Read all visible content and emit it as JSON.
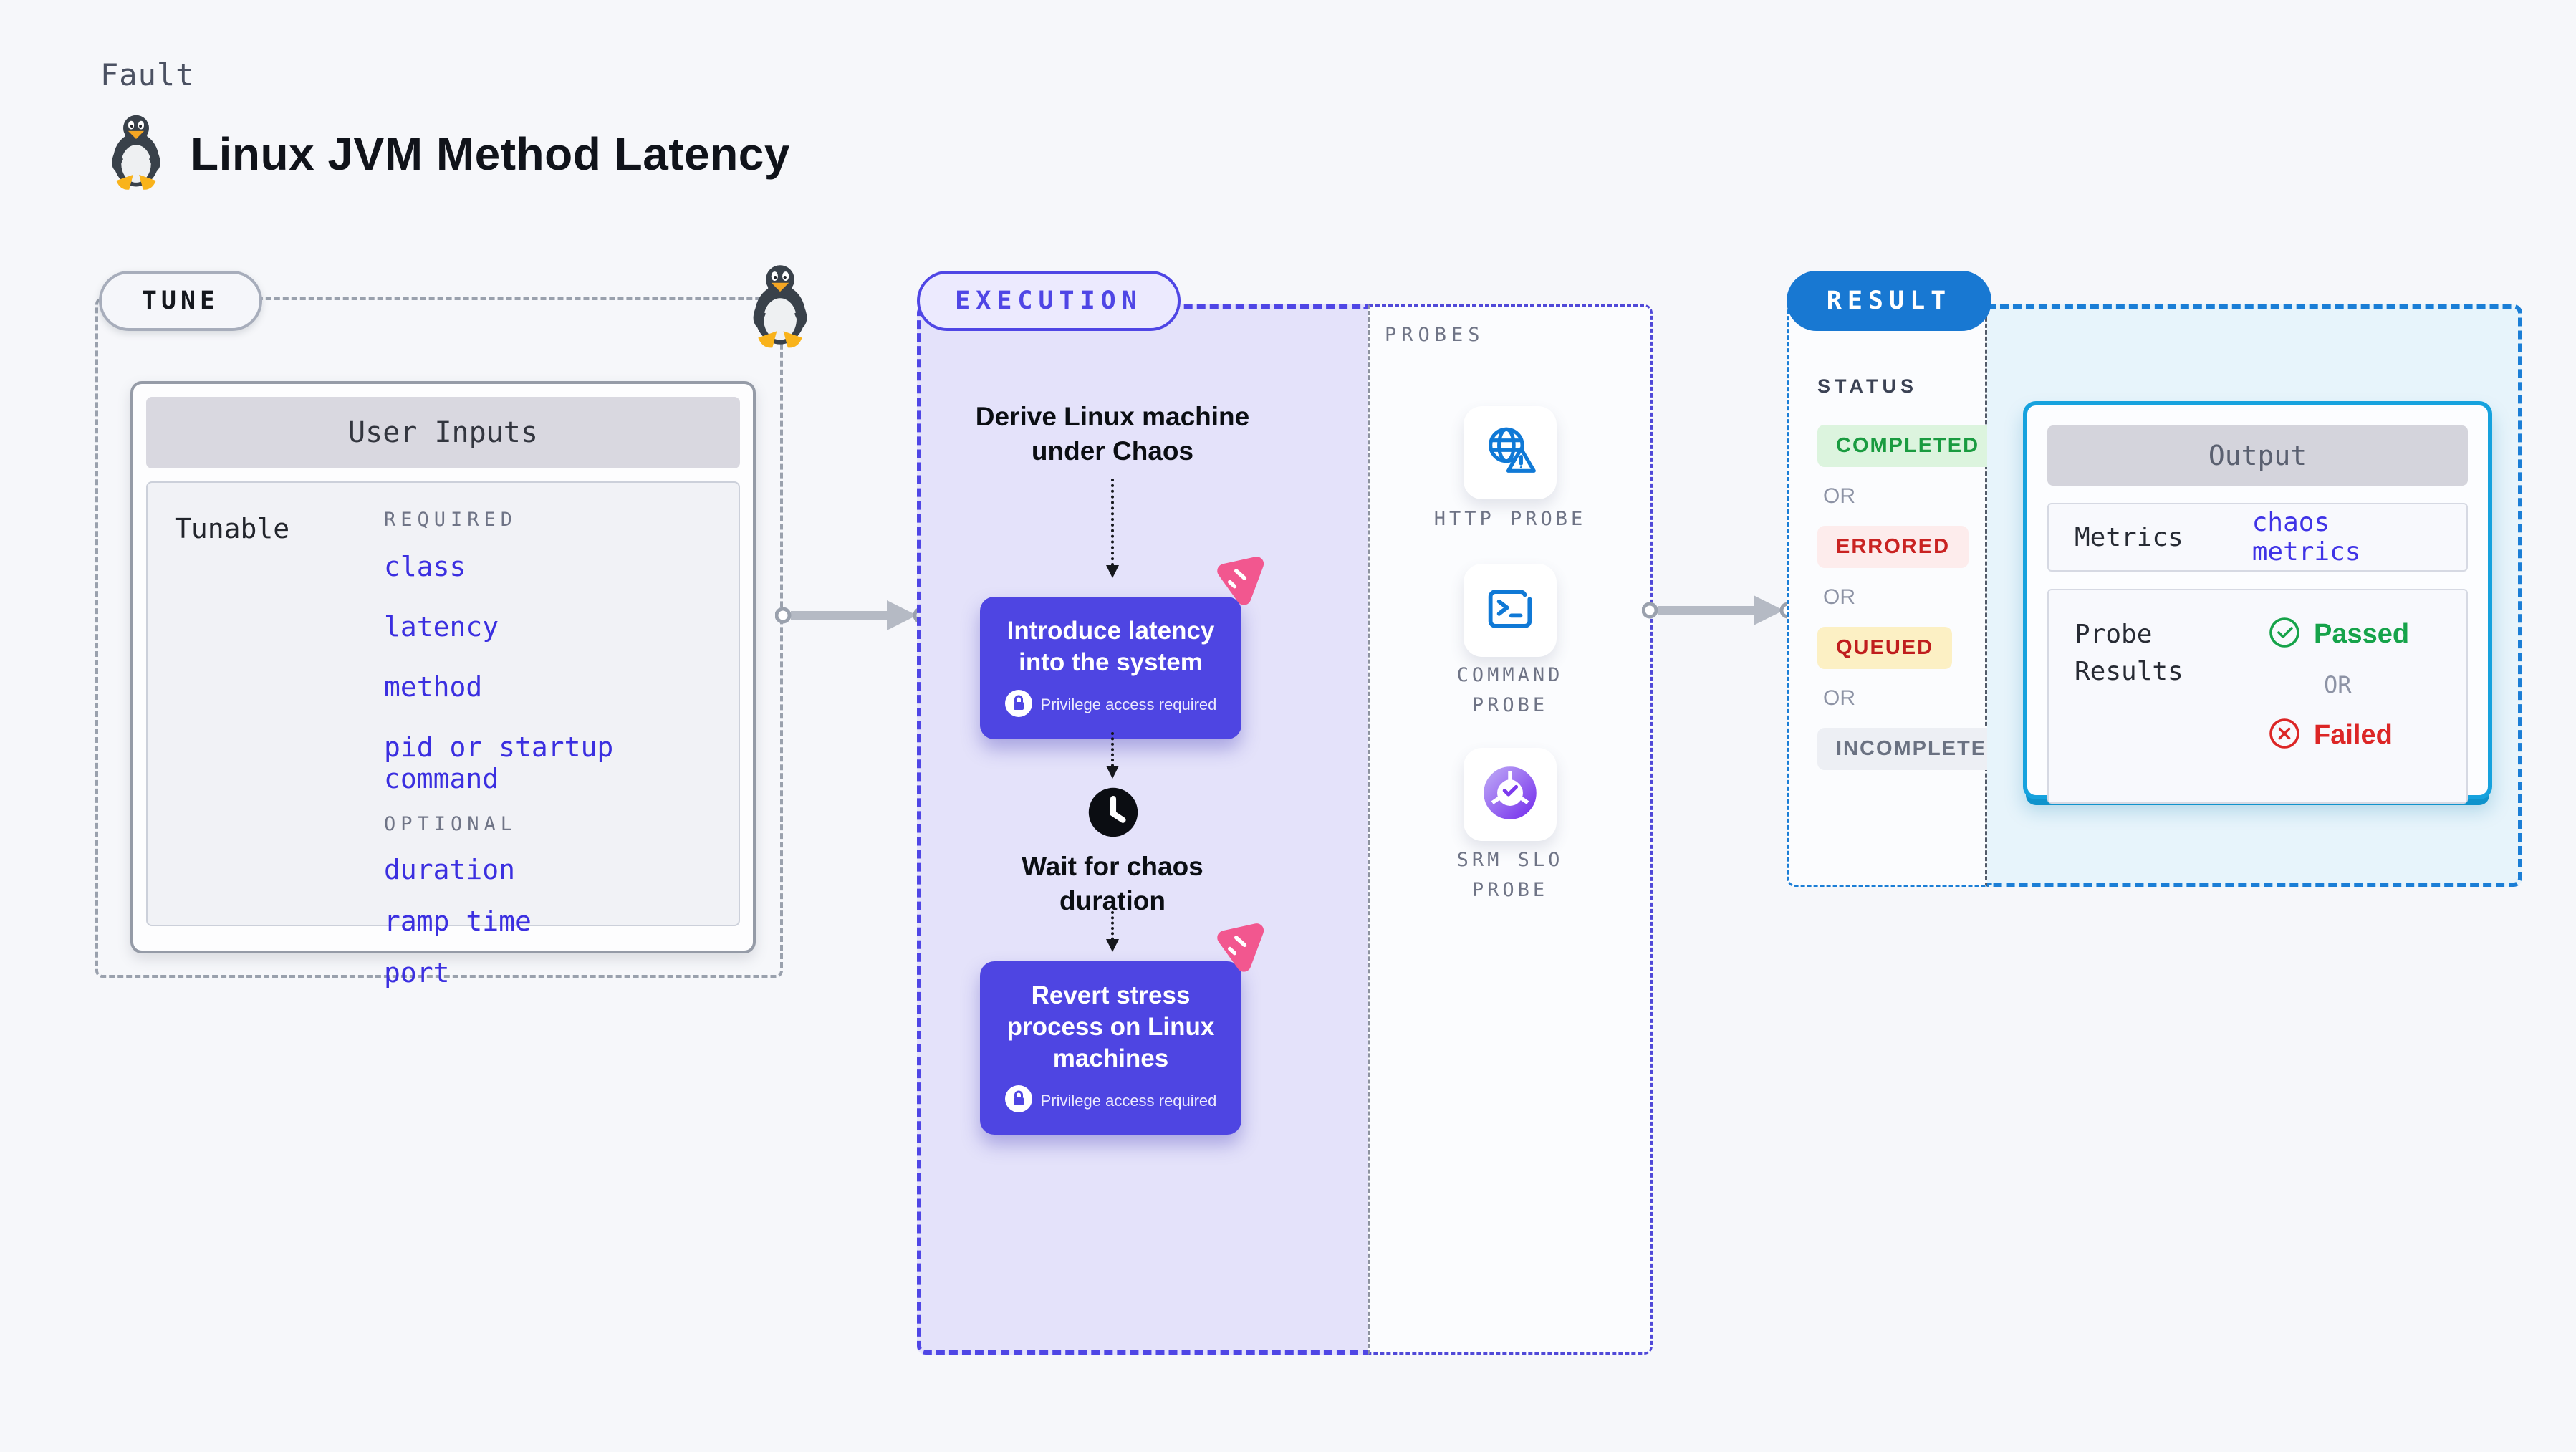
{
  "header": {
    "eyebrow": "Fault",
    "title": "Linux JVM Method Latency",
    "icon": "tux-penguin-icon"
  },
  "tune": {
    "badge": "TUNE",
    "user_inputs_title": "User Inputs",
    "tunable_label": "Tunable",
    "required_label": "REQUIRED",
    "required_items": [
      "class",
      "latency",
      "method",
      "pid or startup command"
    ],
    "optional_label": "OPTIONAL",
    "optional_items": [
      "duration",
      "ramp time",
      "port"
    ]
  },
  "execution": {
    "badge": "EXECUTION",
    "step1": "Derive Linux machine under Chaos",
    "card1_title": "Introduce latency into the system",
    "card1_note": "Privilege access required",
    "wait_step": "Wait for chaos duration",
    "card2_title": "Revert stress process on Linux machines",
    "card2_note": "Privilege access required"
  },
  "probes": {
    "label": "PROBES",
    "items": [
      {
        "name": "HTTP PROBE",
        "icon": "globe-alert-icon"
      },
      {
        "name": "COMMAND PROBE",
        "icon": "terminal-icon"
      },
      {
        "name": "SRM SLO PROBE",
        "icon": "slo-donut-check-icon"
      }
    ]
  },
  "result": {
    "badge": "RESULT",
    "status_label": "STATUS",
    "or_label": "OR",
    "statuses": [
      {
        "label": "COMPLETED"
      },
      {
        "label": "ERRORED"
      },
      {
        "label": "QUEUED"
      },
      {
        "label": "INCOMPLETED"
      }
    ],
    "output": {
      "title": "Output",
      "metrics_label": "Metrics",
      "metrics_value": "chaos metrics",
      "probe_results_label": "Probe Results",
      "passed_label": "Passed",
      "or_label": "OR",
      "failed_label": "Failed"
    }
  },
  "colors": {
    "page_bg": "#f6f7fa",
    "indigo_accent": "#4f46e5",
    "execution_fill": "#e4e2fa",
    "result_blue": "#1878d2",
    "output_border_cyan": "#16a2de",
    "output_fill": "#e7f4fb",
    "tunable_link_blue": "#3b2fe0",
    "completed_green": "#1a9b40",
    "errored_red": "#c92322",
    "queued_red": "#c01e1e",
    "incompleted_gray": "#6b7282",
    "passed_green": "#16a34a",
    "failed_red": "#dc2626",
    "chaos_pink": "#f2578f",
    "arrow_gray": "#b5bac4"
  }
}
